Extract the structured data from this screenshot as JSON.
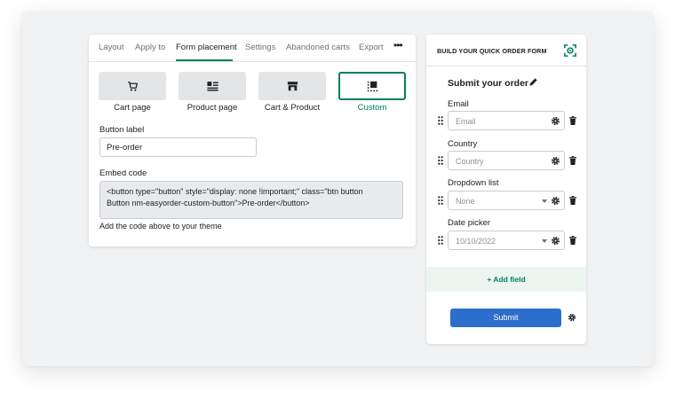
{
  "tabs": [
    {
      "label": "Layout"
    },
    {
      "label": "Apply to"
    },
    {
      "label": "Form placement",
      "active": true
    },
    {
      "label": "Settings"
    },
    {
      "label": "Abandoned carts"
    },
    {
      "label": "Export"
    }
  ],
  "more_label": "•••",
  "placements": [
    {
      "label": "Cart page",
      "icon": "cart-icon"
    },
    {
      "label": "Product page",
      "icon": "product-page-icon"
    },
    {
      "label": "Cart & Product",
      "icon": "store-icon"
    },
    {
      "label": "Custom",
      "icon": "custom-layout-icon",
      "selected": true
    }
  ],
  "button_label": {
    "label": "Button label",
    "value": "Pre-order"
  },
  "embed": {
    "label": "Embed code",
    "line1": "<button type=\"button\" style=\"display: none !important;\" class=\"btn button",
    "line2": "Button nm-easyorder-custom-button\">Pre-order</button>",
    "hint": "Add the code above to your theme"
  },
  "builder": {
    "header": "BUILD YOUR QUICK ORDER FORM",
    "form_title": "Submit your order",
    "fields": [
      {
        "label": "Email",
        "placeholder": "Email",
        "dropdown": false
      },
      {
        "label": "Country",
        "placeholder": "Country",
        "dropdown": false
      },
      {
        "label": "Dropdown list",
        "placeholder": "None",
        "dropdown": true
      },
      {
        "label": "Date picker",
        "placeholder": "10/10/2022",
        "dropdown": true
      }
    ],
    "add_field": "+ Add field",
    "submit": "Submit"
  },
  "colors": {
    "accent": "#008060",
    "primary_button": "#2c6ecb",
    "add_field_bg": "#edf5f1"
  }
}
